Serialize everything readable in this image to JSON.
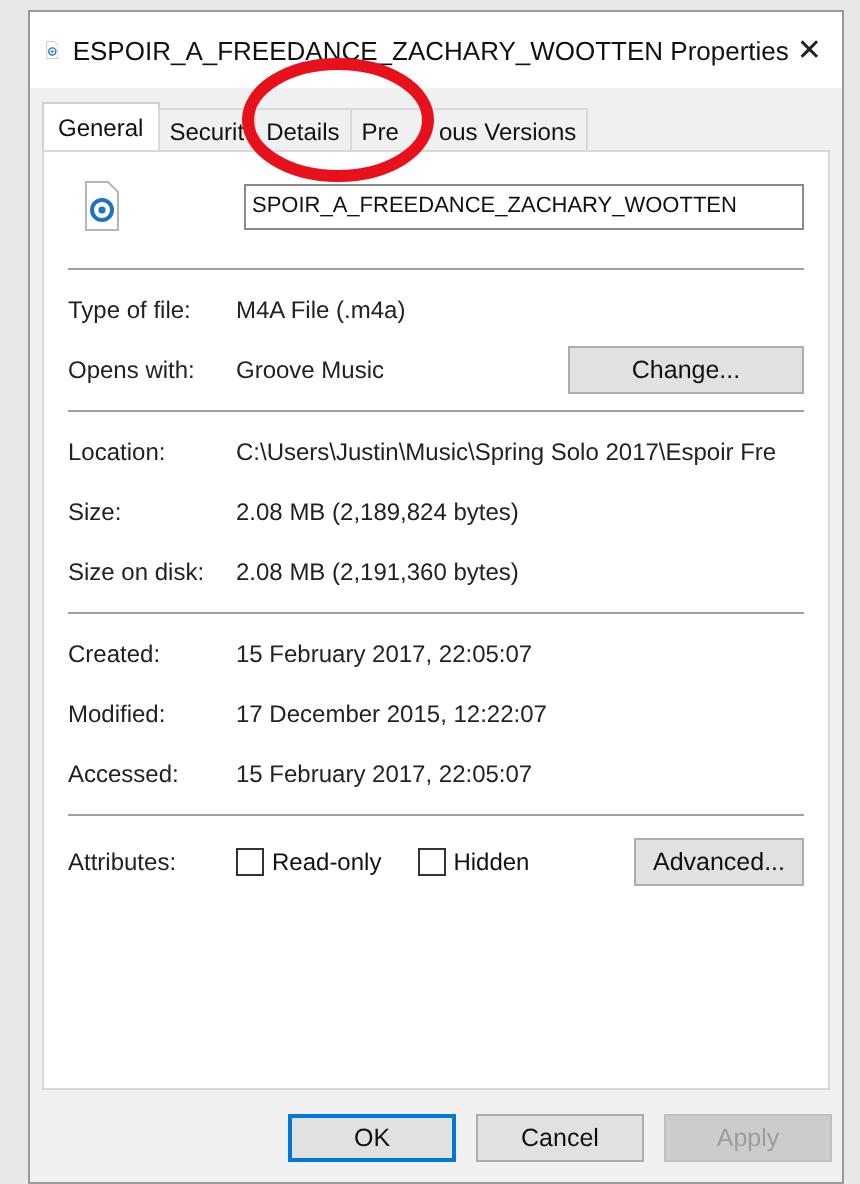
{
  "window": {
    "title": "ESPOIR_A_FREEDANCE_ZACHARY_WOOTTEN Properties",
    "close": "✕"
  },
  "tabs": [
    {
      "label": "General",
      "selected": true
    },
    {
      "label_parts": [
        "Securit"
      ],
      "selected": false
    },
    {
      "label": "Details",
      "selected": false
    },
    {
      "label_parts": [
        "Pre",
        "ous Versions"
      ],
      "selected": false
    }
  ],
  "file_name": {
    "value": "SPOIR_A_FREEDANCE_ZACHARY_WOOTTEN"
  },
  "sections": [
    [
      {
        "label": "Type of file:",
        "value": "M4A File (.m4a)"
      },
      {
        "label": "Opens with:",
        "value": "Groove Music",
        "button": "Change..."
      }
    ],
    [
      {
        "label": "Location:",
        "value": "C:\\Users\\Justin\\Music\\Spring Solo 2017\\Espoir Fre"
      },
      {
        "label": "Size:",
        "value": "2.08 MB (2,189,824 bytes)"
      },
      {
        "label": "Size on disk:",
        "value": "2.08 MB (2,191,360 bytes)"
      }
    ],
    [
      {
        "label": "Created:",
        "value": "15 February 2017, 22:05:07"
      },
      {
        "label": "Modified:",
        "value": "17 December 2015, 12:22:07"
      },
      {
        "label": "Accessed:",
        "value": "15 February 2017, 22:05:07"
      }
    ]
  ],
  "attributes": {
    "label": "Attributes:",
    "checkboxes": [
      {
        "label": "Read-only",
        "checked": false
      },
      {
        "label": "Hidden",
        "checked": false
      }
    ],
    "button": "Advanced..."
  },
  "buttons": [
    {
      "label": "OK",
      "kind": "default",
      "disabled": false
    },
    {
      "label": "Cancel",
      "kind": "normal",
      "disabled": false
    },
    {
      "label": "Apply",
      "kind": "normal",
      "disabled": true
    }
  ],
  "annotation": {
    "kind": "circle",
    "color": "#e8101a"
  }
}
